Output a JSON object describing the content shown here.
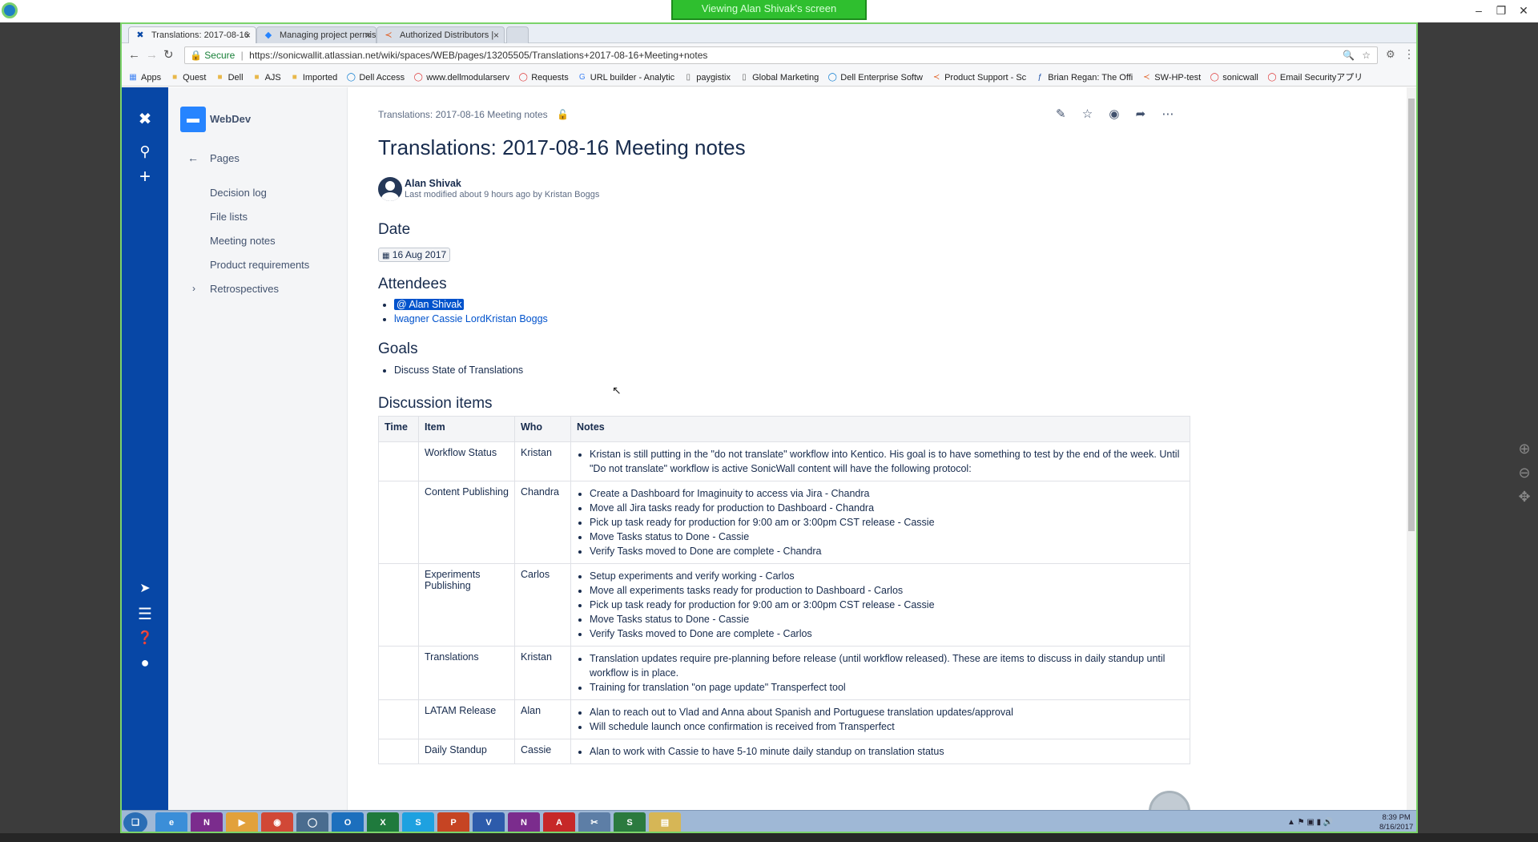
{
  "viewer": {
    "banner": "Viewing Alan Shivak's screen"
  },
  "browser": {
    "tabs": [
      {
        "label": "Translations: 2017-08-16",
        "icon": "confluence-icon"
      },
      {
        "label": "Managing project permis",
        "icon": "jira-icon"
      },
      {
        "label": "Authorized Distributors |",
        "icon": "sonicwall-icon"
      }
    ],
    "secure_label": "Secure",
    "url": "https://sonicwallit.atlassian.net/wiki/spaces/WEB/pages/13205505/Translations+2017-08-16+Meeting+notes",
    "bookmarks": [
      "Apps",
      "Quest",
      "Dell",
      "AJS",
      "Imported",
      "Dell Access",
      "www.dellmodularserv",
      "Requests",
      "URL builder - Analytic",
      "paygistix",
      "Global Marketing",
      "Dell Enterprise Softw",
      "Product Support - Sc",
      "Brian Regan: The Offi",
      "SW-HP-test",
      "sonicwall",
      "Email Securityアプリ"
    ]
  },
  "sidebar": {
    "space_name": "WebDev",
    "pages_label": "Pages",
    "items": [
      "Decision log",
      "File lists",
      "Meeting notes",
      "Product requirements",
      "Retrospectives"
    ]
  },
  "page": {
    "breadcrumb": "Translations: 2017-08-16 Meeting notes",
    "title": "Translations: 2017-08-16 Meeting notes",
    "author": "Alan Shivak",
    "modified": "Last modified about 9 hours ago by Kristan Boggs",
    "date_heading": "Date",
    "date_value": "16 Aug 2017",
    "attendees_heading": "Attendees",
    "attendees": [
      "@ Alan Shivak",
      "lwagner Cassie LordKristan Boggs"
    ],
    "goals_heading": "Goals",
    "goals": [
      "Discuss State of Translations"
    ],
    "discussion_heading": "Discussion items",
    "table_headers": [
      "Time",
      "Item",
      "Who",
      "Notes"
    ],
    "rows": [
      {
        "time": "",
        "item": "Workflow Status",
        "who": "Kristan",
        "notes": [
          "Kristan is still putting in the \"do not translate\" workflow into Kentico. His goal is to have something to test by the end of the week. Until \"Do not translate\" workflow is active SonicWall content will have the following protocol:"
        ]
      },
      {
        "time": "",
        "item": "Content Publishing",
        "who": "Chandra",
        "notes": [
          "Create a Dashboard for Imaginuity to access via Jira - Chandra",
          "Move all Jira tasks ready for production to Dashboard - Chandra",
          "Pick up task ready for production for 9:00 am or 3:00pm CST release - Cassie",
          "Move Tasks status to Done - Cassie",
          "Verify Tasks moved to Done are complete - Chandra"
        ]
      },
      {
        "time": "",
        "item": "Experiments Publishing",
        "who": "Carlos",
        "notes": [
          "Setup experiments and verify working - Carlos",
          "Move all experiments tasks ready for production to Dashboard - Carlos",
          "Pick up task ready for production for 9:00 am or 3:00pm CST release - Cassie",
          "Move Tasks status to Done - Cassie",
          "Verify Tasks moved to Done are complete - Carlos"
        ]
      },
      {
        "time": "",
        "item": "Translations",
        "who": "Kristan",
        "notes": [
          "Translation updates require pre-planning before release (until workflow released). These are items to discuss in daily standup until workflow is in place.",
          "Training for translation \"on page update\" Transperfect tool"
        ]
      },
      {
        "time": "",
        "item": "LATAM Release",
        "who": "Alan",
        "notes": [
          "Alan to reach out to Vlad and Anna about Spanish and Portuguese translation updates/approval",
          "Will schedule launch once confirmation is received from Transperfect"
        ]
      },
      {
        "time": "",
        "item": "Daily Standup",
        "who": "Cassie",
        "notes": [
          "Alan to work with Cassie to have 5-10 minute daily standup on translation status"
        ]
      }
    ]
  },
  "taskbar": {
    "time": "8:39 PM",
    "date": "8/16/2017"
  }
}
